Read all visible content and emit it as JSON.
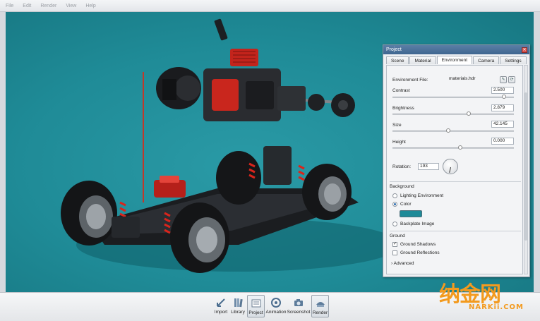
{
  "menu": [
    "File",
    "Edit",
    "Render",
    "View",
    "Help"
  ],
  "panel": {
    "title": "Project",
    "close_icon": "close-icon",
    "tabs": [
      {
        "label": "Scene",
        "active": false
      },
      {
        "label": "Material",
        "active": false
      },
      {
        "label": "Environment",
        "active": true
      },
      {
        "label": "Camera",
        "active": false
      },
      {
        "label": "Settings",
        "active": false
      }
    ],
    "environment_file_label": "Environment File:",
    "environment_file_value": "materials.hdr",
    "contrast_label": "Contrast",
    "contrast_value": "2.500",
    "contrast_level": 0.92,
    "brightness_label": "Brightness",
    "brightness_value": "2.879",
    "brightness_level": 0.63,
    "size_label": "Size",
    "size_value": "42.145",
    "size_level": 0.46,
    "height_label": "Height",
    "height_value": "0.000",
    "height_level": 0.56,
    "rotation_label": "Rotation:",
    "rotation_value": "193",
    "background_title": "Background",
    "bg_options": [
      {
        "label": "Lighting Environment",
        "checked": false
      },
      {
        "label": "Color",
        "checked": true
      },
      {
        "label": "Backplate Image",
        "checked": false
      }
    ],
    "bg_color": "#1e8a98",
    "ground_title": "Ground",
    "ground_options": [
      {
        "label": "Ground Shadows",
        "checked": true
      },
      {
        "label": "Ground Reflections",
        "checked": false
      }
    ],
    "advanced_label": "Advanced"
  },
  "toolbar": {
    "buttons": [
      {
        "label": "Import",
        "icon": "import-icon",
        "active": false
      },
      {
        "label": "Library",
        "icon": "library-icon",
        "active": false
      },
      {
        "label": "Project",
        "icon": "project-icon",
        "active": true
      },
      {
        "label": "Animation",
        "icon": "animation-icon",
        "active": false
      },
      {
        "label": "Screenshot",
        "icon": "screenshot-icon",
        "active": false
      },
      {
        "label": "Render",
        "icon": "render-icon",
        "active": false
      }
    ]
  },
  "watermark": {
    "cn": "纳金网",
    "en": "NARKii.COM"
  },
  "viewport": {
    "background": "#1f8b97",
    "subject": "exploded RC car model"
  }
}
